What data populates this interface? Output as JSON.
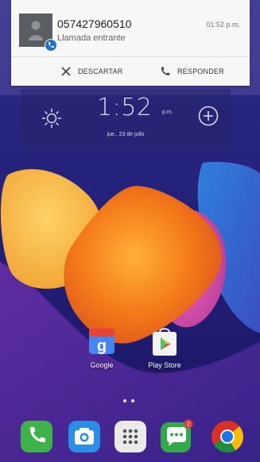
{
  "notification": {
    "number": "057427960510",
    "subtitle": "Llamada entrante",
    "time": "01:52 p.m.",
    "dismiss_label": "DESCARTAR",
    "answer_label": "RESPONDER",
    "avatar_icon": "contact-person-icon",
    "badge_icon": "phone-badge-icon"
  },
  "clock": {
    "time": "1:52",
    "ampm": "p.m.",
    "date": "jue., 23 de julio",
    "weather_icon": "sun-icon",
    "add_icon": "plus-circle-icon"
  },
  "apps": [
    {
      "label": "Google",
      "icon": "google-search-icon"
    },
    {
      "label": "Play Store",
      "icon": "play-store-icon"
    }
  ],
  "dock": [
    {
      "icon": "phone-icon",
      "color": "#3db34a"
    },
    {
      "icon": "camera-icon",
      "color": "#2b8de6"
    },
    {
      "icon": "app-drawer-icon",
      "color": "#e8e8e8"
    },
    {
      "icon": "messages-icon",
      "color": "#34a94a",
      "badge": "2"
    },
    {
      "icon": "chrome-icon",
      "color": "#d93025"
    }
  ],
  "colors": {
    "wallpaper_bg": "#1c1a6a",
    "orange": "#f47a1a",
    "yellow": "#f5b23a",
    "pink": "#e94595",
    "blue": "#2a7bd8"
  }
}
